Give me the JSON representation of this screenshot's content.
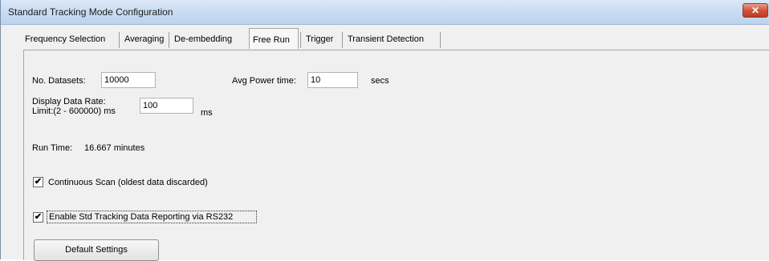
{
  "window": {
    "title": "Standard Tracking Mode Configuration",
    "close_glyph": "✕"
  },
  "tabs": [
    "Frequency Selection",
    "Averaging",
    "De-embedding",
    "Free Run",
    "Trigger",
    "Transient Detection"
  ],
  "active_tab": "Free Run",
  "form": {
    "datasets_label": "No. Datasets:",
    "datasets_value": "10000",
    "avg_power_label": "Avg Power time:",
    "avg_power_value": "10",
    "avg_power_unit": "secs",
    "display_rate_label_1": "Display Data Rate:",
    "display_rate_label_2": "Limit:(2 - 600000) ms",
    "display_rate_value": "100",
    "display_rate_unit": "ms",
    "run_time_label": "Run Time:",
    "run_time_value": "16.667 minutes",
    "continuous_scan_label": "Continuous Scan (oldest data discarded)",
    "continuous_scan_checked": true,
    "std_tracking_label": "Enable Std Tracking Data Reporting via RS232",
    "std_tracking_checked": true,
    "default_button": "Default Settings",
    "check_glyph": "✔"
  }
}
